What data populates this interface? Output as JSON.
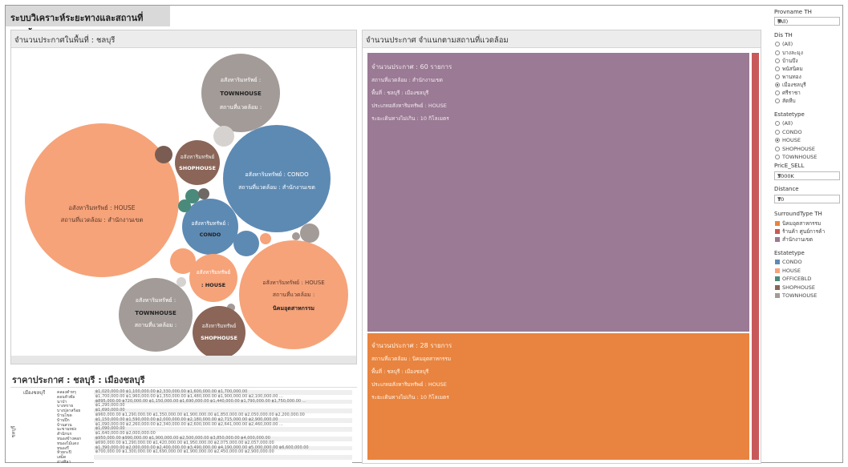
{
  "dashboard_title": "ระบบวิเคราะห์ระยะทางและสถานที่แวดล้อม",
  "bubble_panel": {
    "title": "จำนวนประกาศในพื้นที่ : ชลบุรี",
    "labels": {
      "house1_a": "อสังหาริมทรัพย์ : HOUSE",
      "house1_b": "สถานที่แวดล้อม : สำนักงานเขต",
      "condo1_a": "อสังหาริมทรัพย์ : CONDO",
      "condo1_b": "สถานที่แวดล้อม : สำนักงานเขต",
      "th1_a": "อสังหาริมทรัพย์ :",
      "th1_b": "TOWNHOUSE",
      "th1_c": "สถานที่แวดล้อม :",
      "sh1_a": "อสังหาริมทรัพย์",
      "sh1_b": "SHOPHOUSE",
      "condo2_a": "อสังหาริมทรัพย์ :",
      "condo2_b": "CONDO",
      "house2_a": "อสังหาริมทรัพย์",
      "house2_b": ": HOUSE",
      "house3_a": "อสังหาริมทรัพย์ : HOUSE",
      "house3_b": "สถานที่แวดล้อม :",
      "house3_c": "นิคมอุตสาหกรรม",
      "th2_a": "อสังหาริมทรัพย์ :",
      "th2_b": "TOWNHOUSE",
      "th2_c": "สถานที่แวดล้อม :",
      "sh2_a": "อสังหาริมทรัพย์",
      "sh2_b": "SHOPHOUSE"
    }
  },
  "treemap_panel": {
    "title": "จำนวนประกาศ จำแนกตามสถานที่แวดล้อม",
    "top_block": {
      "count_line": "จำนวนประกาศ : 60 รายการ",
      "surround_line": "สถานที่แวดล้อม : สำนักงานเขต",
      "area_line": "พื้นที่ : ชลบุรี : เมืองชลบุรี",
      "type_line": "ประเภทอสังหาริมทรัพย์ : HOUSE",
      "distance_line": "ระยะเดินทางไม่เกิน : 10 กิโลเมตร"
    },
    "bottom_block": {
      "count_line": "จำนวนประกาศ : 28 รายการ",
      "surround_line": "สถานที่แวดล้อม : นิคมอุตสาหกรรม",
      "area_line": "พื้นที่ : ชลบุรี : เมืองชลบุรี",
      "type_line": "ประเภทอสังหาริมทรัพย์ : HOUSE",
      "distance_line": "ระยะเดินทางไม่เกิน : 10 กิโลเมตร"
    }
  },
  "price_panel": {
    "title": "ราคาประกาศ : ชลบุรี : เมืองชลบุรี",
    "district": "เมืองชลบุรี",
    "province": "ชลบุรี",
    "rows": [
      {
        "label": "คลองตำหรุ",
        "values": "฿1,020,000.00  ฿1,100,000.00  ฿2,330,000.00  ฿1,600,000.00  ฿1,700,000.00"
      },
      {
        "label": "ดอนหัวฬ่อ",
        "values": "฿1,700,000.00  ฿1,960,000.00  ฿1,350,000.00  ฿1,480,000.00  ฿1,900,000.00  ฿2,100,000.00  ..."
      },
      {
        "label": "นาป่า",
        "values": "฿895,000.00  ฿720,000.00  ฿1,150,000.00  ฿1,690,000.00  ฿1,440,000.00  ฿1,790,000.00  ฿1,750,000.00  ..."
      },
      {
        "label": "บางทราย",
        "values": "฿1,290,000.00"
      },
      {
        "label": "บางปลาสร้อย",
        "values": "฿1,690,000.00"
      },
      {
        "label": "บ้านโขด",
        "values": "฿960,000.00  ฿1,290,000.00  ฿1,350,000.00  ฿1,900,000.00  ฿1,850,000.00  ฿2,050,000.00  ฿2,200,000.00"
      },
      {
        "label": "บ้านปึก",
        "values": "฿1,150,000.00  ฿1,590,000.00  ฿2,000,000.00  ฿2,180,000.00  ฿2,715,000.00  ฿2,900,000.00"
      },
      {
        "label": "บ้านสวน",
        "values": "฿1,090,000.00  ฿2,260,000.00  ฿2,340,000.00  ฿2,600,000.00  ฿2,641,000.00  ฿2,460,000.00  ..."
      },
      {
        "label": "มะขามหย่ง",
        "values": "฿1,090,000.00"
      },
      {
        "label": "สำนักบก",
        "values": "฿1,640,000.00  ฿2,000,000.00"
      },
      {
        "label": "หนองข้างคอก",
        "values": "฿950,000.00  ฿990,000.00  ฿1,900,000.00  ฿2,500,000.00  ฿3,850,000.00  ฿4,000,000.00"
      },
      {
        "label": "หนองไม้แดง",
        "values": "฿690,000.00  ฿1,290,000.00  ฿1,420,000.00  ฿1,950,000.00  ฿2,075,000.00  ฿2,057,000.00"
      },
      {
        "label": "หนองรี",
        "values": "฿1,390,000.00  ฿2,000,000.00  ฿2,400,000.00  ฿3,490,000.00  ฿4,190,000.00  ฿5,000,000.00  ฿6,600,000.00"
      },
      {
        "label": "ห้วยกะปิ",
        "values": "฿700,000.00  ฿1,300,000.00  ฿1,690,000.00  ฿1,900,000.00  ฿2,450,000.00  ฿2,900,000.00"
      },
      {
        "label": "เสม็ด",
        "values": ""
      },
      {
        "label": "อ่างศิลา",
        "values": ""
      }
    ]
  },
  "filters": {
    "province": {
      "title": "Provname TH",
      "selected": "(All)"
    },
    "district": {
      "title": "Dis TH",
      "options": [
        "(All)",
        "บางละมุง",
        "บ้านบึง",
        "พนัสนิคม",
        "พานทอง",
        "เมืองชลบุรี",
        "ศรีราชา",
        "สัตหีบ"
      ],
      "selected_index": 5
    },
    "estatetype": {
      "title": "Estatetype",
      "options": [
        "(All)",
        "CONDO",
        "HOUSE",
        "SHOPHOUSE",
        "TOWNHOUSE"
      ],
      "selected_index": 2
    },
    "price": {
      "title": "PricE_SELL",
      "selected": "3000K"
    },
    "distance": {
      "title": "Distance",
      "selected": "10"
    }
  },
  "legend_surround": {
    "title": "SurroundType TH",
    "items": [
      {
        "label": "นิคมอุตสาหกรรม",
        "color": "#e8843f"
      },
      {
        "label": "ร้านค้า ศูนย์การค้า",
        "color": "#c8595a"
      },
      {
        "label": "สำนักงานเขต",
        "color": "#9a7a94"
      }
    ]
  },
  "legend_estate": {
    "title": "Estatetype",
    "items": [
      {
        "label": "CONDO",
        "color": "#5d8ab3"
      },
      {
        "label": "HOUSE",
        "color": "#f6a37a"
      },
      {
        "label": "OFFICEBLD",
        "color": "#4a8a7a"
      },
      {
        "label": "SHOPHOUSE",
        "color": "#8a6558"
      },
      {
        "label": "TOWNHOUSE",
        "color": "#a39b98"
      }
    ]
  },
  "colors": {
    "house": "#f6a37a",
    "condo": "#5d8ab3",
    "townhouse": "#a39b98",
    "shophouse": "#8a6558",
    "office": "#4a8a7a",
    "treemap_top": "#9a7a94",
    "treemap_bottom": "#e8843f",
    "treemap_side": "#c8595a"
  }
}
